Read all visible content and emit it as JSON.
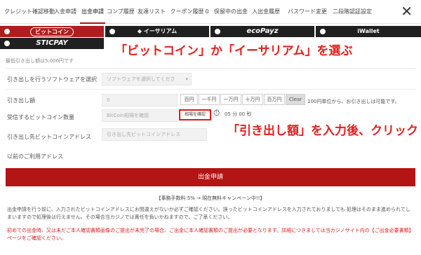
{
  "tabs": [
    {
      "label": "クレジット確認移動"
    },
    {
      "label": "入金申請"
    },
    {
      "label": "出金申請"
    },
    {
      "label": "コンプ履歴"
    },
    {
      "label": "友達リスト"
    },
    {
      "label": "クーポン履歴",
      "count": "0"
    },
    {
      "label": "保留中の出金"
    },
    {
      "label": "入出金履歴"
    },
    {
      "label": "パスワード変更"
    },
    {
      "label": "二段階認証設定"
    }
  ],
  "close_label": "✕",
  "methods": [
    {
      "label": "ビットコイン",
      "selected": true
    },
    {
      "label": "イーサリアム",
      "selected": false
    },
    {
      "label": "ecoPayz",
      "selected": false
    },
    {
      "label": "iWallet",
      "selected": false
    },
    {
      "label": "STICPAY",
      "selected": false
    }
  ],
  "annotations": {
    "choose": "「ビットコイン」か「イーサリアム」を選ぶ",
    "enter": "「引き出し額」を入力後、クリック"
  },
  "form": {
    "min_amount": "最低引き出し額は5,000円です",
    "software_label": "引き出しを行うソフトウェアを選択",
    "software_placeholder": "ソフトウェアを選択してくださ",
    "amount_label": "引き出し額",
    "amount_value": "0",
    "amount_buttons": [
      "百円",
      "一千円",
      "一万円",
      "十万円",
      "百万円",
      "Clear"
    ],
    "amount_hint": "100円単位から、お引き出しは可能です。",
    "btc_amount_label": "受信するビットコイン数量",
    "btc_amount_placeholder": "BitCoin相場を確認",
    "confirm_rate_button": "相場を確認",
    "timer_text": "05 分 00 秒",
    "btc_address_label": "引き出し先ビットコインアドレス",
    "btc_address_placeholder": "引き出し先ビットコインアドレス",
    "previous_address_label": "以前のご利用アドレス",
    "submit_button": "出金申請"
  },
  "fee_text": "【事務手数料 5% → 現在無料キャンペーン中!!】",
  "notes": {
    "warning": "出金申請を行う前に、入力されたビットコインアドレスにお間違えがないか必ずご確認ください。誤ったビットコインアドレスを入力されておりましても 処理はそのまま進められてしまいますので処理後は行えません。その場合当カジノでは責任を負いかねますので、ご了承ください。",
    "kyc": "初めての出金時、又は未だご本人確認書類画像のご提出が未完了の場合、ご出金に本人確認書類のご提出が必要となります。詳細につきましては当カジノサイト内の【ご出金必要書類】ページをご確認ください。"
  },
  "colors": {
    "accent": "#b31414",
    "annotation": "#e32020"
  }
}
